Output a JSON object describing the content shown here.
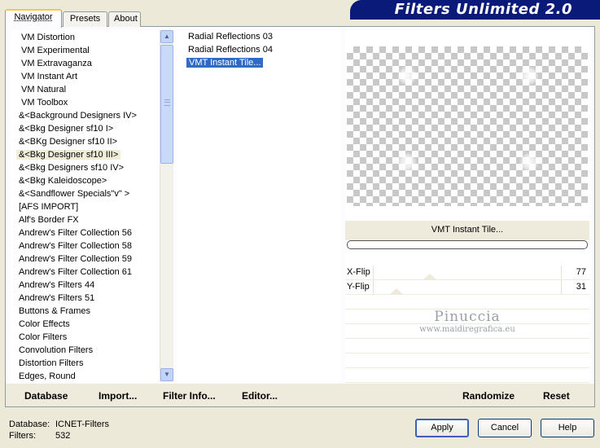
{
  "app": {
    "title": "Filters Unlimited 2.0"
  },
  "tabs": [
    {
      "label": "Navigator",
      "active": true
    },
    {
      "label": "Presets",
      "active": false
    },
    {
      "label": "About",
      "active": false
    }
  ],
  "categories": [
    "VM Distortion",
    "VM Experimental",
    "VM Extravaganza",
    "VM Instant Art",
    "VM Natural",
    "VM Toolbox",
    "&<Background Designers IV>",
    "&<Bkg Designer sf10 I>",
    "&<BKg Designer sf10 II>",
    "&<Bkg Designer sf10 III>",
    "&<Bkg Designers sf10 IV>",
    "&<Bkg Kaleidoscope>",
    "&<Sandflower Specials\"v\" >",
    "[AFS IMPORT]",
    "Alf's Border FX",
    "Andrew's Filter Collection 56",
    "Andrew's Filter Collection 58",
    "Andrew's Filter Collection 59",
    "Andrew's Filter Collection 61",
    "Andrew's Filters 44",
    "Andrew's Filters 51",
    "Buttons & Frames",
    "Color Effects",
    "Color Filters",
    "Convolution Filters",
    "Distortion Filters",
    "Edges, Round"
  ],
  "selected_category_index": 9,
  "filters": [
    "Radial Reflections 03",
    "Radial Reflections 04",
    "VMT Instant Tile..."
  ],
  "selected_filter_index": 2,
  "preview": {
    "filter_name": "VMT Instant Tile..."
  },
  "params": [
    {
      "label": "X-Flip",
      "value": "77",
      "level": 0.3
    },
    {
      "label": "Y-Flip",
      "value": "31",
      "level": 0.12
    }
  ],
  "watermark": {
    "title": "Pinuccia",
    "url": "www.maidiregrafica.eu"
  },
  "toolbar": {
    "database": "Database",
    "import": "Import...",
    "filter_info": "Filter Info...",
    "editor": "Editor...",
    "randomize": "Randomize",
    "reset": "Reset"
  },
  "footer": {
    "database_label": "Database:",
    "database_value": "ICNET-Filters",
    "filters_label": "Filters:",
    "filters_value": "532"
  },
  "buttons": {
    "apply": "Apply",
    "cancel": "Cancel",
    "help": "Help"
  },
  "colors": {
    "banner": "#0a1a78",
    "selection": "#316ac5",
    "tab_highlight": "#ffc83c"
  }
}
